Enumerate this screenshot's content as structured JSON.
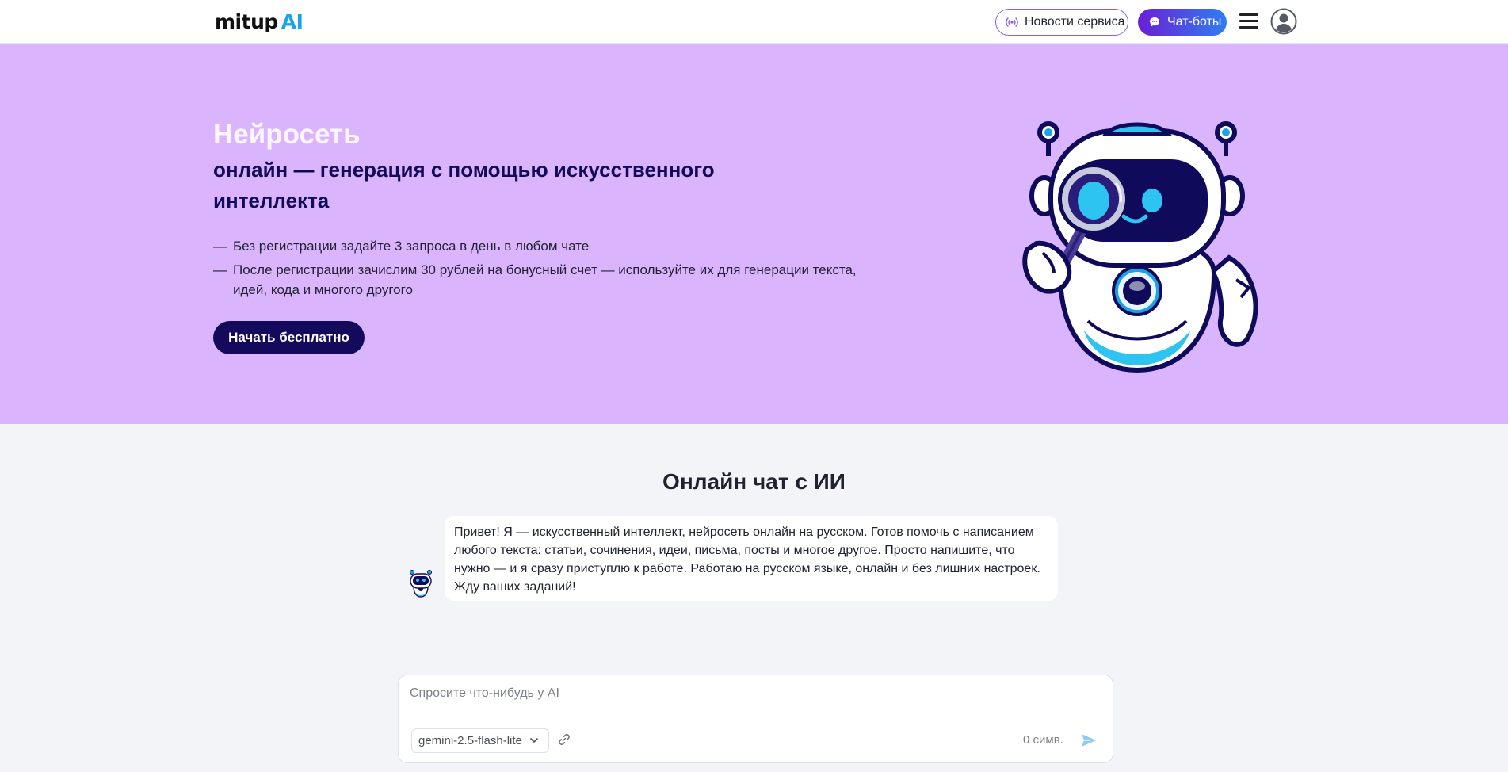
{
  "header": {
    "logo_main": "mitup",
    "logo_ai": "AI",
    "news_label": "Новости сервиса",
    "chatbots_label": "Чат-боты"
  },
  "hero": {
    "title": "Нейросеть",
    "subtitle": "онлайн — генерация с помощью искусственного интеллекта",
    "bullets": [
      "Без регистрации задайте 3 запроса в день в любом чате",
      "После регистрации зачислим 30 рублей на бонусный счет — используйте их для генерации текста, идей, кода и многого другого"
    ],
    "bullet_marker": "—",
    "cta_label": "Начать бесплатно"
  },
  "chat": {
    "title": "Онлайн чат с ИИ",
    "greeting": "Привет! Я — искусственный интеллект, нейросеть онлайн на русском. Готов помочь с написанием любого текста: статьи, сочинения, идеи, письма, посты и многое другое. Просто напишите, что нужно — и я сразу приступлю к работе. Работаю на русском языке, онлайн и без лишних настроек. Жду ваших заданий!"
  },
  "composer": {
    "placeholder": "Спросите что-нибудь у AI",
    "model": "gemini-2.5-flash-lite",
    "counter": "0 симв."
  },
  "colors": {
    "hero_bg": "#dab5fd",
    "accent_dark": "#140a5c",
    "ai_blue": "#1aa3e8",
    "news_border": "#8a5cf5",
    "chatbots_gradient_start": "#6a1fd6",
    "chatbots_gradient_end": "#2f7ef0"
  },
  "icons": {
    "news": "broadcast-icon",
    "chatbots": "chat-bubble-icon",
    "menu": "hamburger-icon",
    "account": "user-avatar-icon",
    "model": "chevron-down-icon",
    "attach": "link-icon",
    "send": "send-icon"
  }
}
